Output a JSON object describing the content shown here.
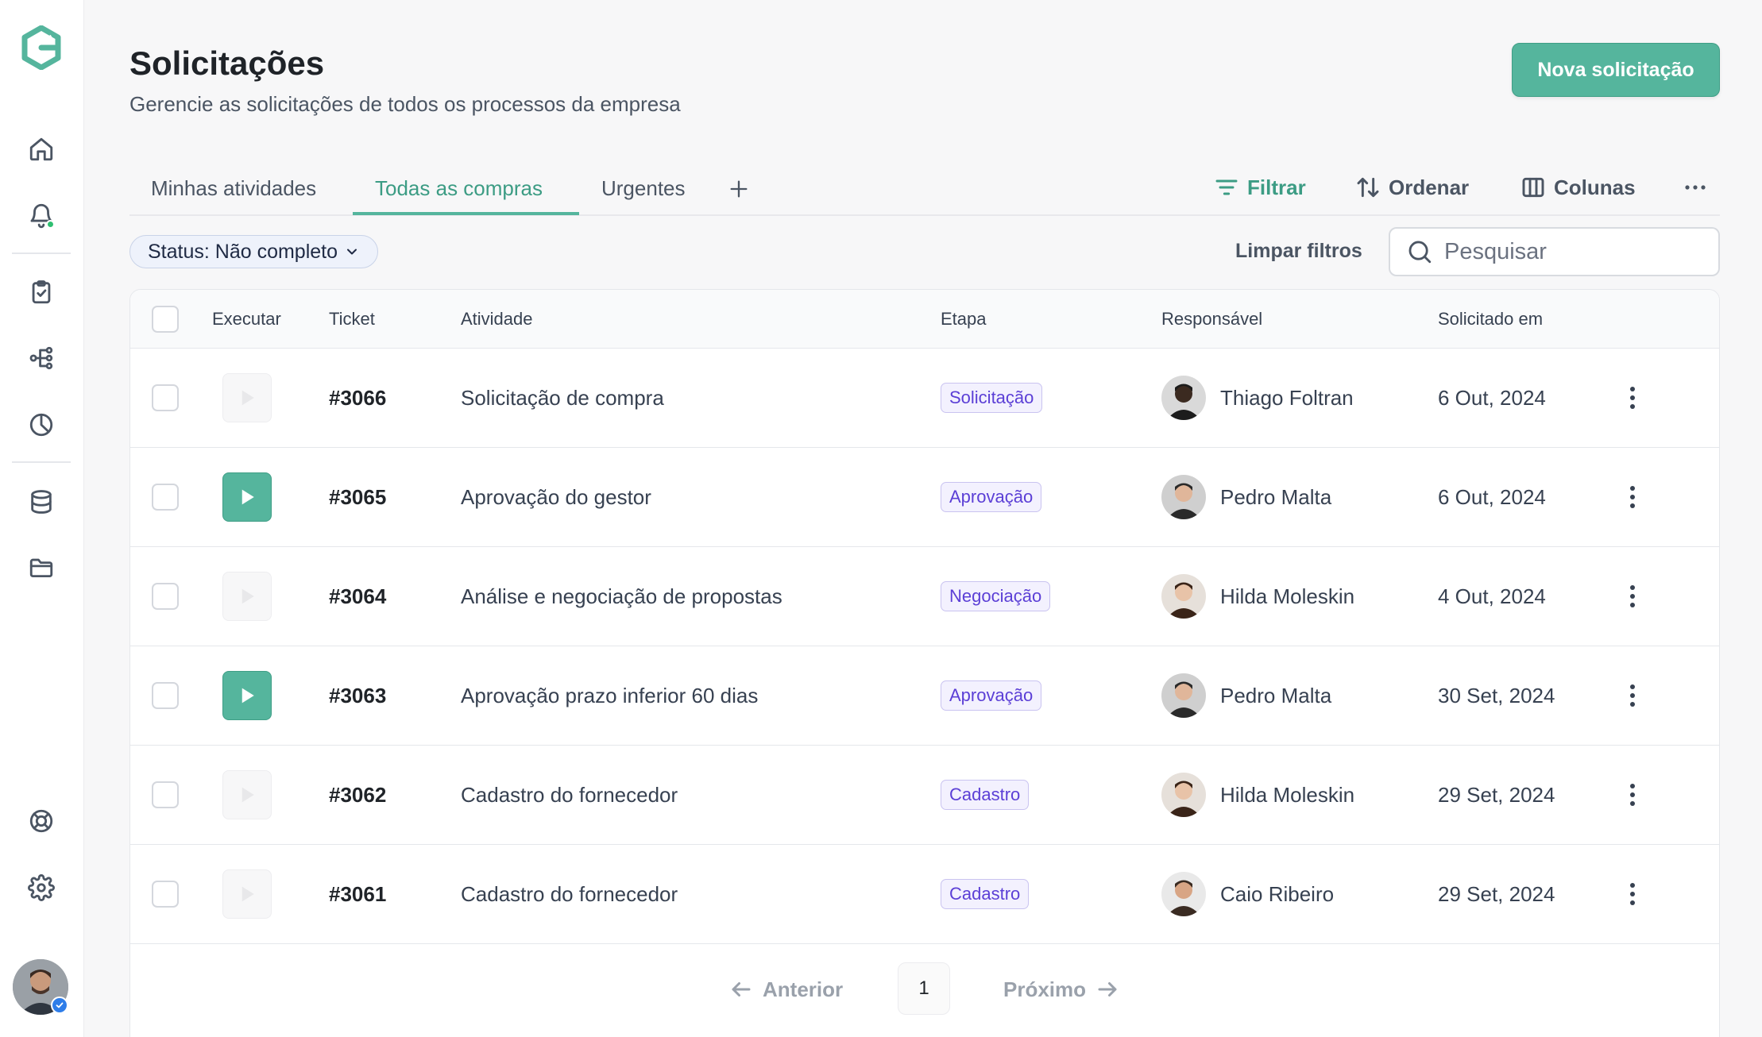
{
  "page": {
    "title": "Solicitações",
    "subtitle": "Gerencie as solicitações de todos os processos da empresa",
    "primary_action": "Nova solicitação"
  },
  "tabs": [
    {
      "label": "Minhas atividades",
      "active": false
    },
    {
      "label": "Todas as compras",
      "active": true
    },
    {
      "label": "Urgentes",
      "active": false
    }
  ],
  "toolbar": {
    "filter_label": "Filtrar",
    "sort_label": "Ordenar",
    "columns_label": "Colunas"
  },
  "filters": {
    "chip_label": "Status: Não completo",
    "clear_label": "Limpar filtros"
  },
  "search": {
    "placeholder": "Pesquisar",
    "value": ""
  },
  "table": {
    "columns": [
      "Executar",
      "Ticket",
      "Atividade",
      "Etapa",
      "Responsável",
      "Solicitado em"
    ],
    "rows": [
      {
        "ticket": "#3066",
        "activity": "Solicitação de compra",
        "stage": "Solicitação",
        "assignee": "Thiago Foltran",
        "date": "6 Out, 2024",
        "executable": false
      },
      {
        "ticket": "#3065",
        "activity": "Aprovação do gestor",
        "stage": "Aprovação",
        "assignee": "Pedro Malta",
        "date": "6 Out, 2024",
        "executable": true
      },
      {
        "ticket": "#3064",
        "activity": "Análise e negociação de propostas",
        "stage": "Negociação",
        "assignee": "Hilda Moleskin",
        "date": "4 Out, 2024",
        "executable": false
      },
      {
        "ticket": "#3063",
        "activity": "Aprovação prazo inferior 60 dias",
        "stage": "Aprovação",
        "assignee": "Pedro Malta",
        "date": "30 Set, 2024",
        "executable": true
      },
      {
        "ticket": "#3062",
        "activity": "Cadastro do fornecedor",
        "stage": "Cadastro",
        "assignee": "Hilda Moleskin",
        "date": "29 Set, 2024",
        "executable": false
      },
      {
        "ticket": "#3061",
        "activity": "Cadastro do fornecedor",
        "stage": "Cadastro",
        "assignee": "Caio Ribeiro",
        "date": "29 Set, 2024",
        "executable": false
      }
    ]
  },
  "pagination": {
    "prev_label": "Anterior",
    "current_page": "1",
    "next_label": "Próximo"
  },
  "sidebar": {
    "icons": [
      "logo-icon",
      "home-icon",
      "bell-icon",
      "clipboard-check-icon",
      "workflow-icon",
      "pie-chart-icon",
      "database-icon",
      "folder-icon",
      "help-lifebuoy-icon",
      "gear-icon"
    ]
  },
  "colors": {
    "accent": "#55b59d",
    "accent_text": "#3c9c84",
    "badge_text": "#5b3fd6",
    "badge_bg": "#f3f1fe",
    "notification_dot": "#2fbf71",
    "verified": "#2e7de9"
  }
}
